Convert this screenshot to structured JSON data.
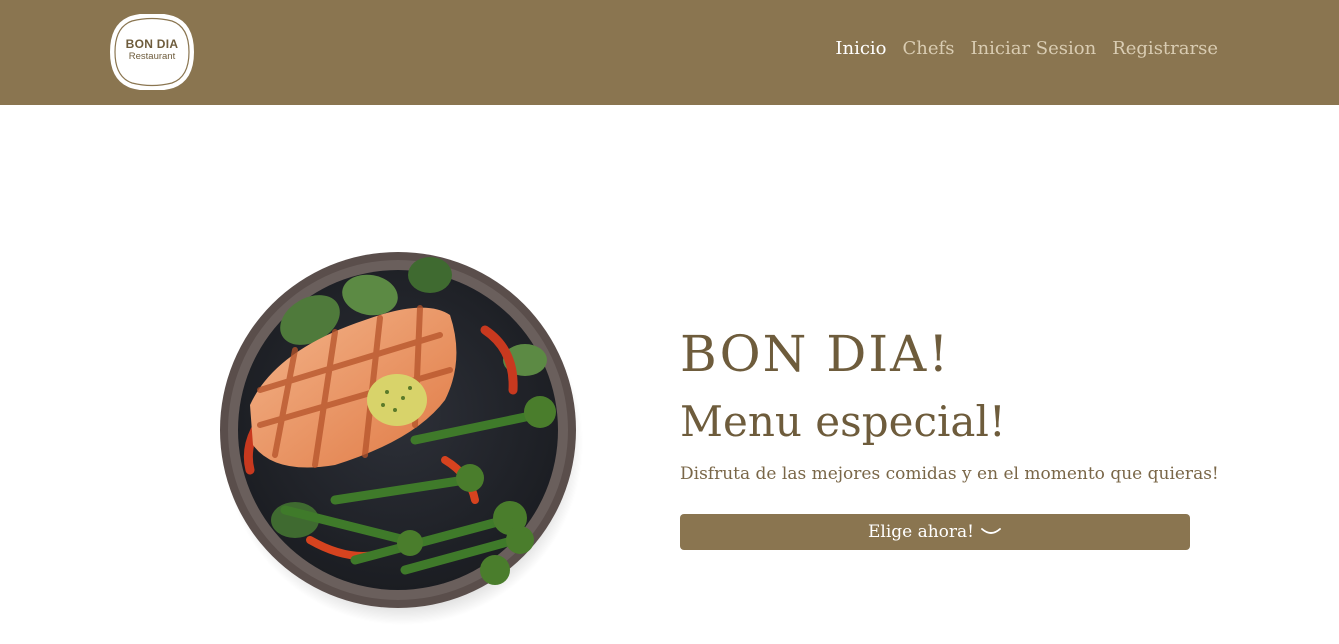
{
  "brand": {
    "name": "BON DIA",
    "subtitle": "Restaurant"
  },
  "nav": {
    "items": [
      {
        "label": "Inicio",
        "active": true
      },
      {
        "label": "Chefs",
        "active": false
      },
      {
        "label": "Iniciar Sesion",
        "active": false
      },
      {
        "label": "Registrarse",
        "active": false
      }
    ]
  },
  "hero": {
    "title": "BON DIA!",
    "subtitle": "Menu especial!",
    "description": "Disfruta de las mejores comidas y en el momento que quieras!",
    "cta_label": "Elige ahora!"
  },
  "colors": {
    "brand": "#8a7550",
    "text": "#6e5c3c",
    "nav_inactive": "#d9ccb2"
  },
  "icons": {
    "cta": "chevron-down-icon",
    "image": "salmon-plate-image"
  }
}
